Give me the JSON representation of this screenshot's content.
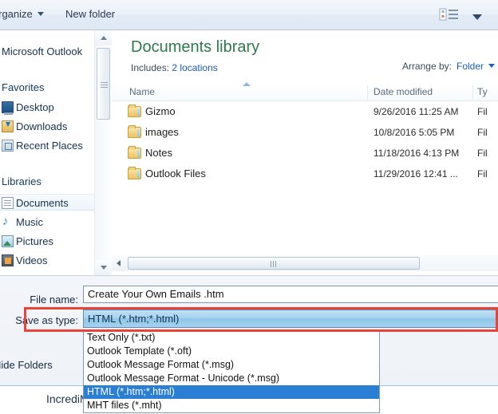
{
  "toolbar": {
    "organize_label": "Organize",
    "new_folder_label": "New folder",
    "view_icon": "list-view-icon",
    "view_caret_icon": "chevron-down-icon"
  },
  "navpane": {
    "top_item": "Microsoft Outlook",
    "groups": [
      {
        "header": "Favorites",
        "items": [
          {
            "label": "Desktop",
            "icon": "desktop-icon"
          },
          {
            "label": "Downloads",
            "icon": "downloads-icon"
          },
          {
            "label": "Recent Places",
            "icon": "recent-places-icon"
          }
        ]
      },
      {
        "header": "Libraries",
        "items": [
          {
            "label": "Documents",
            "icon": "documents-icon"
          },
          {
            "label": "Music",
            "icon": "music-icon"
          },
          {
            "label": "Pictures",
            "icon": "pictures-icon"
          },
          {
            "label": "Videos",
            "icon": "videos-icon"
          }
        ]
      }
    ]
  },
  "library": {
    "title": "Documents library",
    "includes_label": "Includes:",
    "includes_value": "2 locations",
    "arrange_label": "Arrange by:",
    "arrange_value": "Folder"
  },
  "filelist": {
    "columns": [
      "Name",
      "Date modified",
      "Ty"
    ],
    "rows": [
      {
        "name": "Gizmo",
        "date": "9/26/2016 11:25 AM",
        "type": "Fil"
      },
      {
        "name": "images",
        "date": "10/8/2016 5:05 PM",
        "type": "Fil"
      },
      {
        "name": "Notes",
        "date": "11/18/2016 4:13 PM",
        "type": "Fil"
      },
      {
        "name": "Outlook Files",
        "date": "11/29/2016 12:41 ...",
        "type": "Fil"
      }
    ]
  },
  "form": {
    "filename_label": "File name:",
    "filename_value": "Create Your Own Emails .htm",
    "savetype_label": "Save as type:",
    "savetype_value": "HTML (*.htm;*.html)",
    "hide_folders_label": "Hide Folders"
  },
  "dropdown": {
    "options": [
      "Text Only (*.txt)",
      "Outlook Template (*.oft)",
      "Outlook Message Format (*.msg)",
      "Outlook Message Format - Unicode (*.msg)",
      "HTML (*.htm;*.html)",
      "MHT files (*.mht)"
    ],
    "selected_index": 4
  },
  "footer": {
    "text": "IncrediM"
  },
  "colors": {
    "library_title": "#2e7a4f",
    "link": "#1a5fb4",
    "selection": "#2a7fd4",
    "annotation": "#e8443a"
  }
}
